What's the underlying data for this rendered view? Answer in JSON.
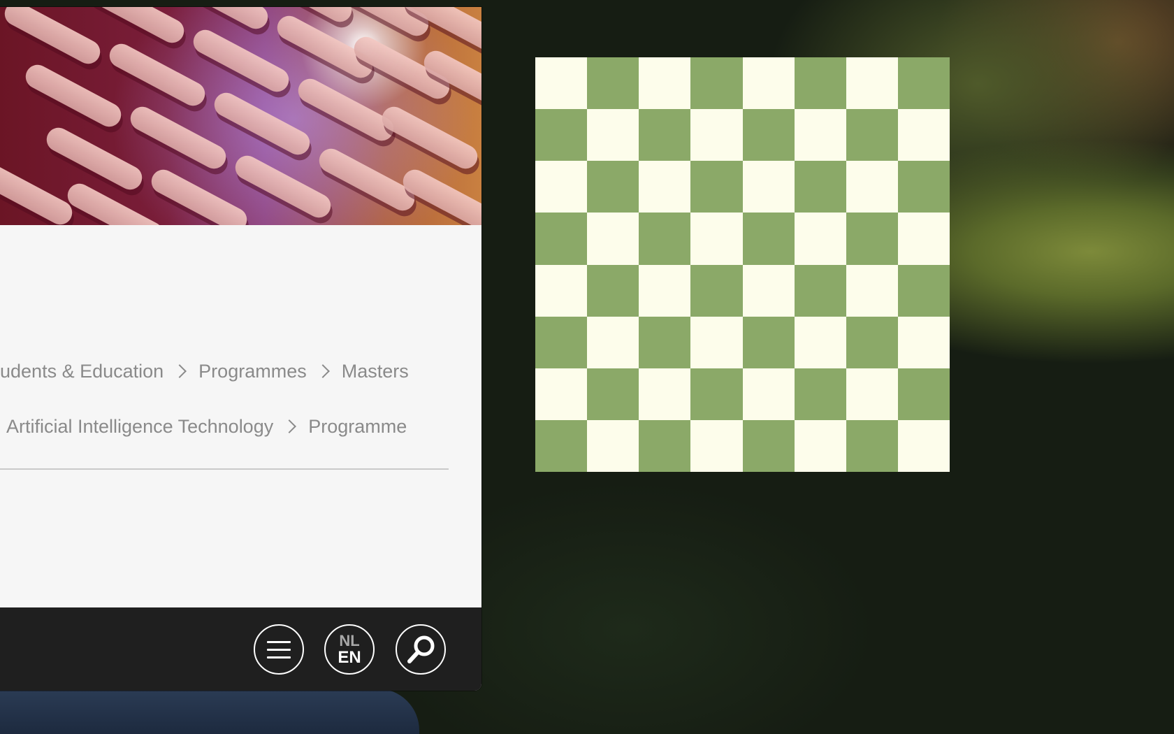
{
  "breadcrumb": {
    "row1": [
      "udents & Education",
      "Programmes",
      "Masters"
    ],
    "row2": [
      "Artificial Intelligence Technology",
      "Programme"
    ]
  },
  "footer": {
    "menu_icon": "hamburger-menu-icon",
    "language_switch": {
      "nl": "NL",
      "en": "EN"
    },
    "search_icon": "search-icon"
  },
  "chessboard": {
    "size": 8,
    "light_color": "#fdfdeb",
    "dark_color": "#8ba968"
  }
}
